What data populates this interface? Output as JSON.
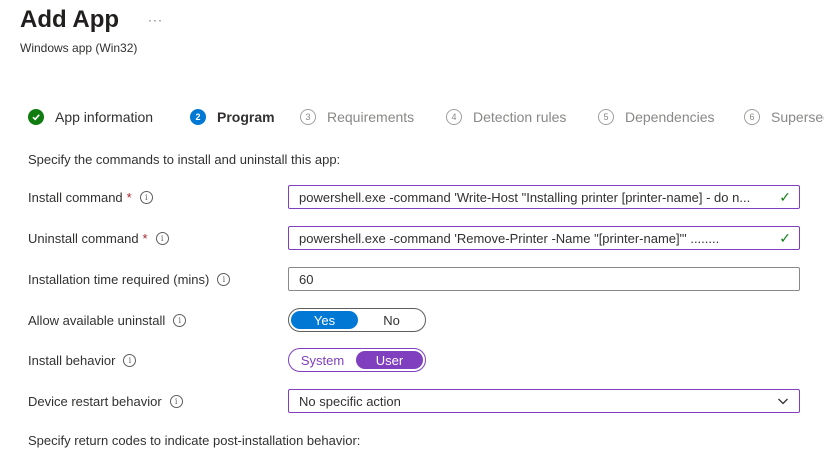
{
  "header": {
    "title": "Add App",
    "more": "···",
    "subtitle": "Windows app (Win32)"
  },
  "steps": [
    {
      "number": "✓",
      "label": "App information",
      "state": "done"
    },
    {
      "number": "2",
      "label": "Program",
      "state": "active"
    },
    {
      "number": "3",
      "label": "Requirements",
      "state": "pending"
    },
    {
      "number": "4",
      "label": "Detection rules",
      "state": "pending"
    },
    {
      "number": "5",
      "label": "Dependencies",
      "state": "pending"
    },
    {
      "number": "6",
      "label": "Supersedence",
      "state": "pending"
    }
  ],
  "form": {
    "intro": "Specify the commands to install and uninstall this app:",
    "install_command": {
      "label": "Install command",
      "required": "*",
      "value": "powershell.exe -command 'Write-Host \"Installing printer [printer-name] - do n..."
    },
    "uninstall_command": {
      "label": "Uninstall command",
      "required": "*",
      "value": "powershell.exe -command 'Remove-Printer -Name \"[printer-name]\"' ........"
    },
    "install_time": {
      "label": "Installation time required (mins)",
      "value": "60"
    },
    "allow_uninstall": {
      "label": "Allow available uninstall",
      "options": [
        "Yes",
        "No"
      ],
      "selected": "Yes"
    },
    "install_behavior": {
      "label": "Install behavior",
      "options": [
        "System",
        "User"
      ],
      "selected": "User"
    },
    "restart_behavior": {
      "label": "Device restart behavior",
      "value": "No specific action"
    },
    "return_codes_intro": "Specify return codes to indicate post-installation behavior:"
  },
  "icons": {
    "info": "info-icon",
    "valid": "checkmark-icon",
    "dropdown": "chevron-down-icon"
  },
  "colors": {
    "accent_blue": "#0078d4",
    "accent_purple": "#7f3fbf",
    "success_green": "#107c10",
    "required_red": "#a4262c"
  }
}
